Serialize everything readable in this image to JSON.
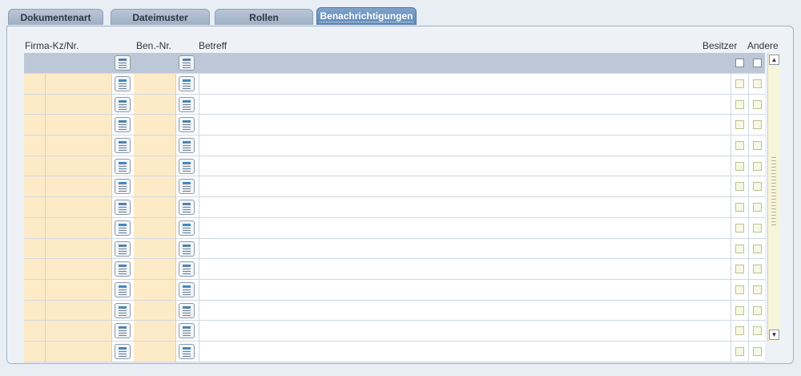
{
  "tabs": [
    {
      "label": "Dokumentenart"
    },
    {
      "label": "Dateimuster"
    },
    {
      "label": "Rollen"
    },
    {
      "label": "Benachrichtigungen"
    }
  ],
  "columns": {
    "firma": "Firma-Kz/Nr.",
    "ben": "Ben.-Nr.",
    "betreff": "Betreff",
    "besitzer": "Besitzer",
    "andere": "Andere"
  },
  "rows": [
    {
      "firma_kz": "",
      "firma_nr": "",
      "ben_nr": "",
      "betreff": "",
      "besitzer": false,
      "andere": false
    },
    {
      "firma_kz": "",
      "firma_nr": "",
      "ben_nr": "",
      "betreff": "",
      "besitzer": false,
      "andere": false
    },
    {
      "firma_kz": "",
      "firma_nr": "",
      "ben_nr": "",
      "betreff": "",
      "besitzer": false,
      "andere": false
    },
    {
      "firma_kz": "",
      "firma_nr": "",
      "ben_nr": "",
      "betreff": "",
      "besitzer": false,
      "andere": false
    },
    {
      "firma_kz": "",
      "firma_nr": "",
      "ben_nr": "",
      "betreff": "",
      "besitzer": false,
      "andere": false
    },
    {
      "firma_kz": "",
      "firma_nr": "",
      "ben_nr": "",
      "betreff": "",
      "besitzer": false,
      "andere": false
    },
    {
      "firma_kz": "",
      "firma_nr": "",
      "ben_nr": "",
      "betreff": "",
      "besitzer": false,
      "andere": false
    },
    {
      "firma_kz": "",
      "firma_nr": "",
      "ben_nr": "",
      "betreff": "",
      "besitzer": false,
      "andere": false
    },
    {
      "firma_kz": "",
      "firma_nr": "",
      "ben_nr": "",
      "betreff": "",
      "besitzer": false,
      "andere": false
    },
    {
      "firma_kz": "",
      "firma_nr": "",
      "ben_nr": "",
      "betreff": "",
      "besitzer": false,
      "andere": false
    },
    {
      "firma_kz": "",
      "firma_nr": "",
      "ben_nr": "",
      "betreff": "",
      "besitzer": false,
      "andere": false
    },
    {
      "firma_kz": "",
      "firma_nr": "",
      "ben_nr": "",
      "betreff": "",
      "besitzer": false,
      "andere": false
    },
    {
      "firma_kz": "",
      "firma_nr": "",
      "ben_nr": "",
      "betreff": "",
      "besitzer": false,
      "andere": false
    },
    {
      "firma_kz": "",
      "firma_nr": "",
      "ben_nr": "",
      "betreff": "",
      "besitzer": false,
      "andere": false
    }
  ],
  "icons": {
    "lov": "list-of-values-icon",
    "scroll_up": "scroll-up-arrow-icon",
    "scroll_down": "scroll-down-arrow-icon"
  },
  "colors": {
    "active_tab": "#5f88b6",
    "key_field": "#fdebc8",
    "header_row": "#bcc8d8"
  }
}
